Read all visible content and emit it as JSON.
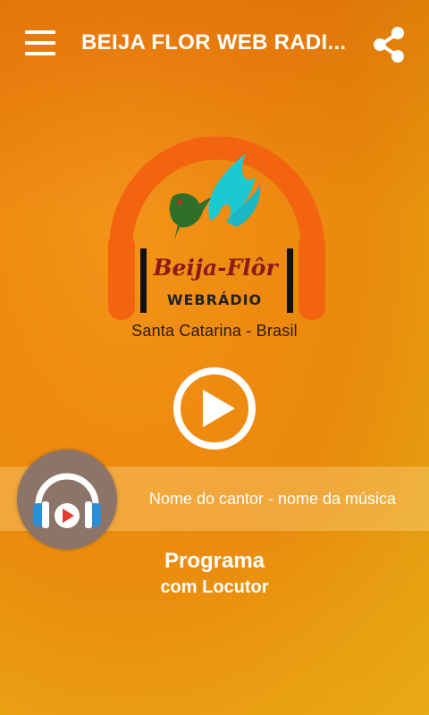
{
  "toolbar": {
    "title": "BEIJA FLOR WEB RADI...",
    "menu_icon": "hamburger-menu-icon",
    "share_icon": "share-icon"
  },
  "logo": {
    "line1": "Beija-Flôr",
    "line2": "WEBRÁDIO",
    "caption": "Santa Catarina - Brasil"
  },
  "player": {
    "play_icon": "play-icon",
    "now_playing": "Nome do cantor - nome da música"
  },
  "program": {
    "name": "Programa",
    "host": "com Locutor"
  },
  "colors": {
    "background": "#ee8a10",
    "headphone": "#f2640f",
    "avatar_bg": "#8c7468",
    "accent_red": "#e53a2d",
    "accent_blue": "#2b8fd8"
  }
}
